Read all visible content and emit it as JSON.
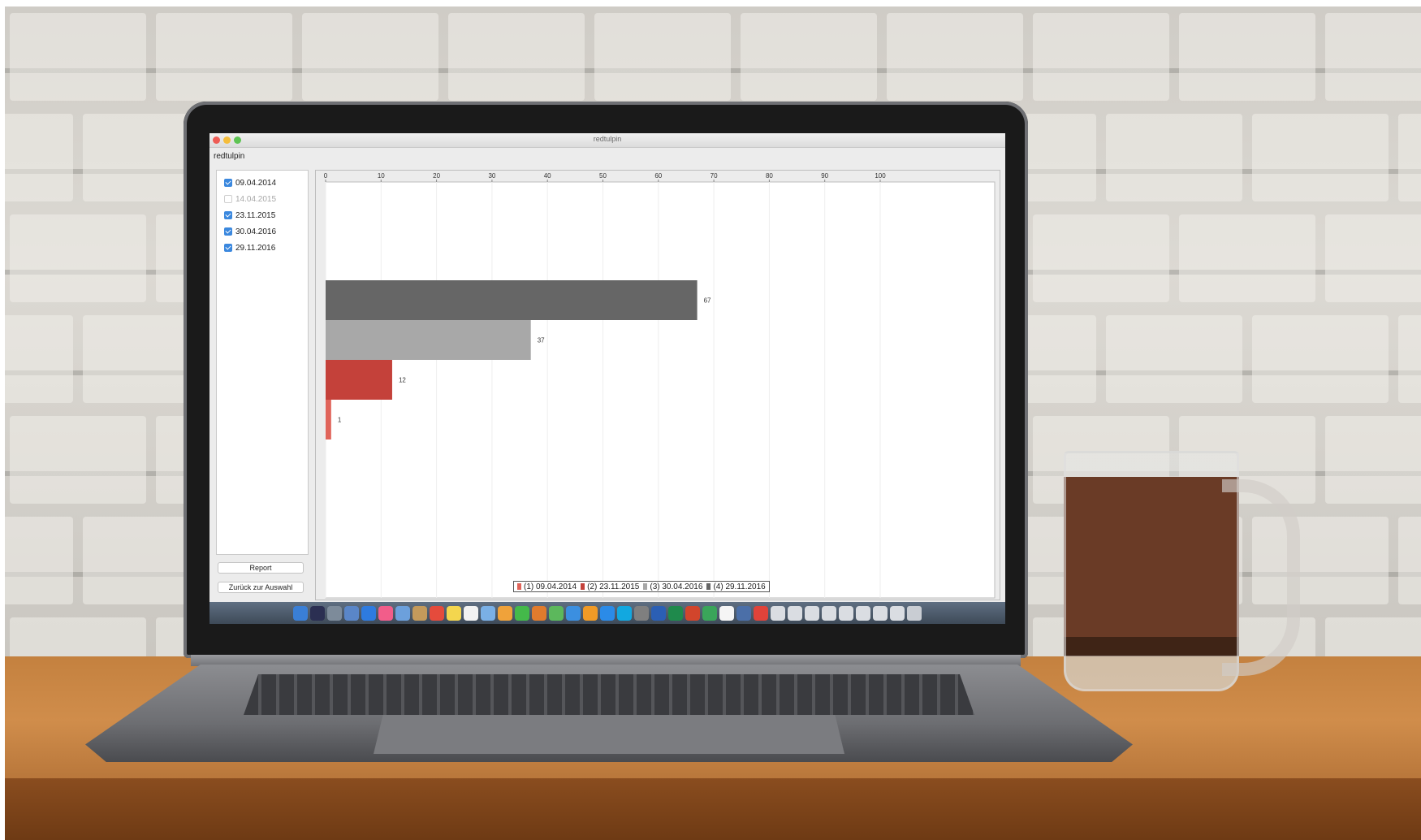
{
  "window": {
    "title": "redtulpin",
    "app_label": "redtulpin"
  },
  "sidebar": {
    "dates": [
      {
        "label": "09.04.2014",
        "checked": true,
        "enabled": true
      },
      {
        "label": "14.04.2015",
        "checked": false,
        "enabled": false
      },
      {
        "label": "23.11.2015",
        "checked": true,
        "enabled": true
      },
      {
        "label": "30.04.2016",
        "checked": true,
        "enabled": true
      },
      {
        "label": "29.11.2016",
        "checked": true,
        "enabled": true
      }
    ],
    "report_label": "Report",
    "back_label": "Zurück zur Auswahl"
  },
  "chart_data": {
    "type": "bar",
    "orientation": "horizontal",
    "xlim": [
      0,
      100
    ],
    "x_ticks": [
      0,
      10,
      20,
      30,
      40,
      50,
      60,
      70,
      80,
      90,
      100
    ],
    "x_axis_position": "top",
    "grid": true,
    "series": [
      {
        "name": "(1) 09.04.2014",
        "value": 1,
        "color": "#e0645a"
      },
      {
        "name": "(2) 23.11.2015",
        "value": 12,
        "color": "#c4413a"
      },
      {
        "name": "(3) 30.04.2016",
        "value": 37,
        "color": "#a8a8a8"
      },
      {
        "name": "(4) 29.11.2016",
        "value": 67,
        "color": "#666666"
      }
    ],
    "legend_placement": "bottom-center"
  },
  "legend": {
    "items": [
      "(1) 09.04.2014",
      "(2) 23.11.2015",
      "(3) 30.04.2016",
      "(4) 29.11.2016"
    ]
  },
  "colors": {
    "close": "#ee5c55",
    "minimize": "#f5bd3b",
    "zoom": "#5ec453",
    "checkbox": "#3b88de"
  },
  "dock": {
    "icons": [
      "finder-icon",
      "siri-icon",
      "launchpad-icon",
      "safari-icon",
      "compass-icon",
      "music-icon",
      "photos-icon",
      "book-icon",
      "calendar-icon",
      "notes-icon",
      "reminders-icon",
      "preview-icon",
      "photos-color-icon",
      "messages-icon",
      "pages-icon",
      "numbers-icon",
      "keynote-icon",
      "ibooks-icon",
      "app-store-icon",
      "skype-icon",
      "system-prefs-icon",
      "word-icon",
      "excel-icon",
      "powerpoint-icon",
      "keynote-green-icon",
      "textedit-icon",
      "drive-icon",
      "eq-icon",
      "window-icon",
      "window-icon",
      "window-icon",
      "window-icon",
      "window-icon",
      "window-icon",
      "window-icon",
      "window-icon",
      "trash-icon"
    ]
  }
}
